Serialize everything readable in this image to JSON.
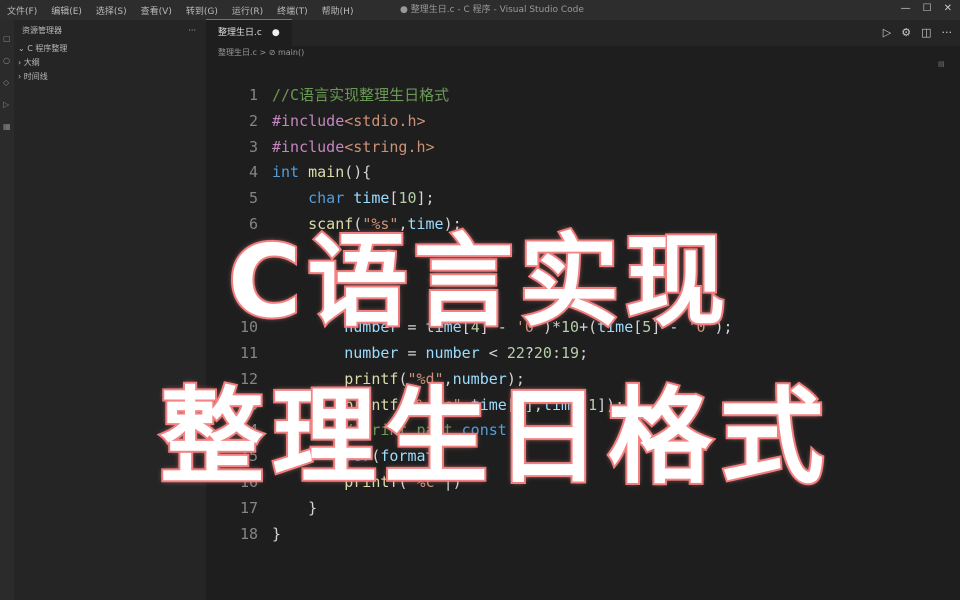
{
  "menu": [
    "文件(F)",
    "编辑(E)",
    "选择(S)",
    "查看(V)",
    "转到(G)",
    "运行(R)",
    "终端(T)",
    "帮助(H)"
  ],
  "window_title": "● 整理生日.c - C 程序 - Visual Studio Code",
  "sidebar": {
    "title": "资源管理器",
    "more": "···",
    "items": [
      "C 程序整理",
      "大纲",
      "时间线"
    ]
  },
  "editor": {
    "tab_label": "整理生日.c",
    "tab_dirty": "●",
    "breadcrumb": "整理生日.c > ⊘ main()",
    "lines": [
      {
        "n": "1",
        "parts": [
          [
            "cmt",
            "//C语言实现整理生日格式"
          ]
        ]
      },
      {
        "n": "2",
        "parts": [
          [
            "pp",
            "#include"
          ],
          [
            "inc",
            "<stdio.h>"
          ]
        ]
      },
      {
        "n": "3",
        "parts": [
          [
            "pp",
            "#include"
          ],
          [
            "inc",
            "<string.h>"
          ]
        ]
      },
      {
        "n": "4",
        "parts": [
          [
            "kw",
            "int "
          ],
          [
            "fn",
            "main"
          ],
          [
            "plain",
            "(){"
          ]
        ]
      },
      {
        "n": "5",
        "parts": [
          [
            "plain",
            "    "
          ],
          [
            "kw",
            "char "
          ],
          [
            "var",
            "time"
          ],
          [
            "plain",
            "["
          ],
          [
            "num",
            "10"
          ],
          [
            "plain",
            "];"
          ]
        ]
      },
      {
        "n": "6",
        "parts": [
          [
            "plain",
            "    "
          ],
          [
            "fn",
            "scanf"
          ],
          [
            "plain",
            "("
          ],
          [
            "str",
            "\"%s\""
          ],
          [
            "plain",
            ","
          ],
          [
            "var",
            "time"
          ],
          [
            "plain",
            ");"
          ]
        ]
      },
      {
        "n": "10",
        "parts": [
          [
            "plain",
            "        "
          ],
          [
            "var",
            "number"
          ],
          [
            "plain",
            " = "
          ],
          [
            "var",
            "time"
          ],
          [
            "plain",
            "["
          ],
          [
            "num",
            "4"
          ],
          [
            "plain",
            "] - "
          ],
          [
            "str",
            "'0'"
          ],
          [
            "plain",
            ")*"
          ],
          [
            "num",
            "10"
          ],
          [
            "plain",
            "+("
          ],
          [
            "var",
            "time"
          ],
          [
            "plain",
            "["
          ],
          [
            "num",
            "5"
          ],
          [
            "plain",
            "] - "
          ],
          [
            "str",
            "'0'"
          ],
          [
            "plain",
            ");"
          ]
        ]
      },
      {
        "n": "11",
        "parts": [
          [
            "plain",
            "        "
          ],
          [
            "var",
            "number"
          ],
          [
            "plain",
            " = "
          ],
          [
            "var",
            "number"
          ],
          [
            "plain",
            " < "
          ],
          [
            "num",
            "22"
          ],
          [
            "plain",
            "?"
          ],
          [
            "num",
            "20"
          ],
          [
            "plain",
            ":"
          ],
          [
            "num",
            "19"
          ],
          [
            "plain",
            ";"
          ]
        ]
      },
      {
        "n": "12",
        "parts": [
          [
            "plain",
            "        "
          ],
          [
            "fn",
            "printf"
          ],
          [
            "plain",
            "("
          ],
          [
            "str",
            "\"%d\""
          ],
          [
            "plain",
            ","
          ],
          [
            "var",
            "number"
          ],
          [
            "plain",
            ");"
          ]
        ]
      },
      {
        "n": "13",
        "parts": [
          [
            "plain",
            "        "
          ],
          [
            "fn",
            "printf"
          ],
          [
            "plain",
            "("
          ],
          [
            "str",
            "\"%c%c\""
          ],
          [
            "plain",
            ","
          ],
          [
            "var",
            "time"
          ],
          [
            "plain",
            "["
          ],
          [
            "num",
            "0"
          ],
          [
            "plain",
            "],"
          ],
          [
            "var",
            "time"
          ],
          [
            "plain",
            "["
          ],
          [
            "num",
            "1"
          ],
          [
            "plain",
            "]);"
          ]
        ]
      },
      {
        "n": "14",
        "parts": [
          [
            "plain",
            "        "
          ],
          [
            "cmt",
            "//Print part"
          ],
          [
            "plain",
            " "
          ],
          [
            "kw",
            "const"
          ]
        ]
      },
      {
        "n": "15",
        "parts": [
          [
            "plain",
            "        "
          ],
          [
            "kw",
            "for"
          ],
          [
            "plain",
            "("
          ],
          [
            "var",
            "format"
          ]
        ]
      },
      {
        "n": "16",
        "parts": [
          [
            "plain",
            "        "
          ],
          [
            "fn",
            "printf"
          ],
          [
            "plain",
            "("
          ],
          [
            "str",
            "\"%c\""
          ],
          [
            "plain",
            "|)"
          ]
        ]
      },
      {
        "n": "17",
        "parts": [
          [
            "plain",
            "    }"
          ]
        ]
      },
      {
        "n": "18",
        "parts": [
          [
            "plain",
            "}"
          ]
        ]
      }
    ],
    "line_slots": [
      0,
      1,
      2,
      3,
      4,
      5,
      9,
      10,
      11,
      12,
      13,
      14,
      15,
      16,
      17
    ]
  },
  "overlay": {
    "line1": "C语言实现",
    "line2": "整理生日格式"
  },
  "colors": {
    "overlay_stroke": "#f07e7e",
    "overlay_fill": "#ffffff",
    "editor_bg": "#1e1e1e"
  }
}
